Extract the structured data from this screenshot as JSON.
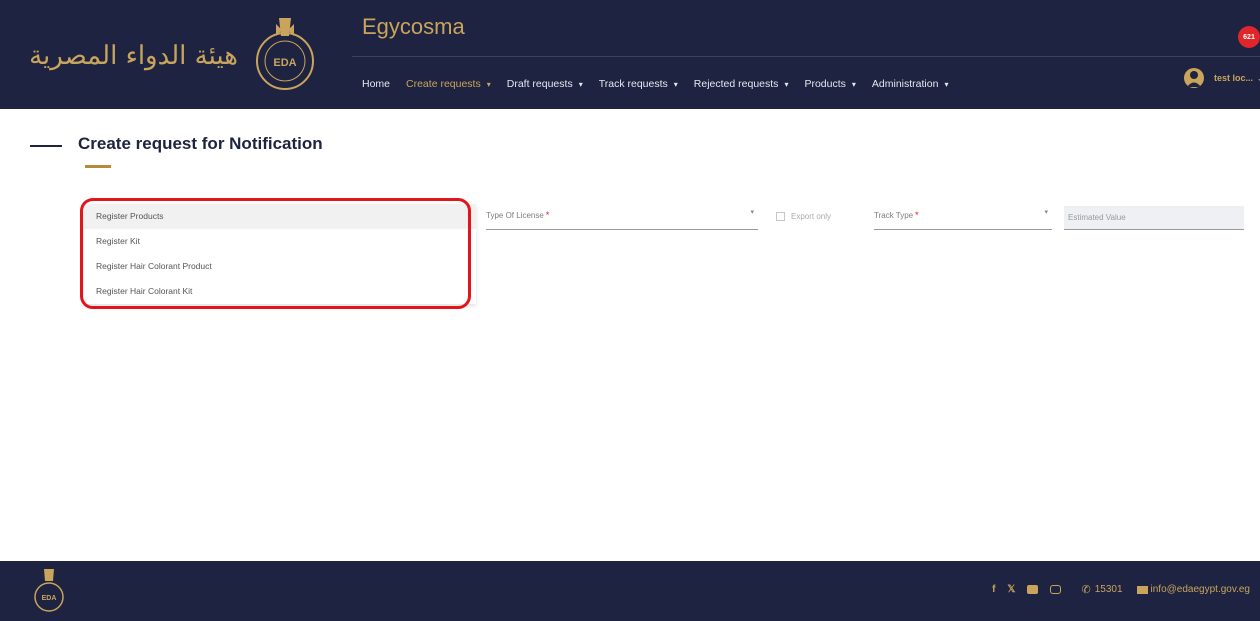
{
  "colors": {
    "header_bg": "#1d2340",
    "accent_gold": "#c9a45c",
    "required": "#e4141b",
    "annotation": "#e4141b"
  },
  "header": {
    "logo_arabic": "هيئة الدواء المصرية",
    "emblem_text": "EDA",
    "app_title": "Egycosma",
    "notifications_count": "621",
    "user_name": "test loc..."
  },
  "nav": [
    {
      "label": "Home",
      "dropdown": false,
      "active": false
    },
    {
      "label": "Create requests",
      "dropdown": true,
      "active": true
    },
    {
      "label": "Draft requests",
      "dropdown": true,
      "active": false
    },
    {
      "label": "Track requests",
      "dropdown": true,
      "active": false
    },
    {
      "label": "Rejected requests",
      "dropdown": true,
      "active": false
    },
    {
      "label": "Products",
      "dropdown": true,
      "active": false
    },
    {
      "label": "Administration",
      "dropdown": true,
      "active": false
    }
  ],
  "page": {
    "title": "Create request for Notification"
  },
  "request_type_options": [
    {
      "label": "Register Products",
      "selected": true
    },
    {
      "label": "Register Kit",
      "selected": false
    },
    {
      "label": "Register Hair Colorant Product",
      "selected": false
    },
    {
      "label": "Register Hair Colorant Kit",
      "selected": false
    }
  ],
  "form": {
    "type_of_license_label": "Type Of License",
    "export_only_label": "Export only",
    "track_type_label": "Track Type",
    "estimated_value_placeholder": "Estimated Value",
    "required_mark": "*"
  },
  "footer": {
    "phone": "15301",
    "email": "info@edaegypt.gov.eg",
    "social_icons": [
      "facebook-icon",
      "twitter-icon",
      "youtube-icon",
      "instagram-icon"
    ]
  }
}
